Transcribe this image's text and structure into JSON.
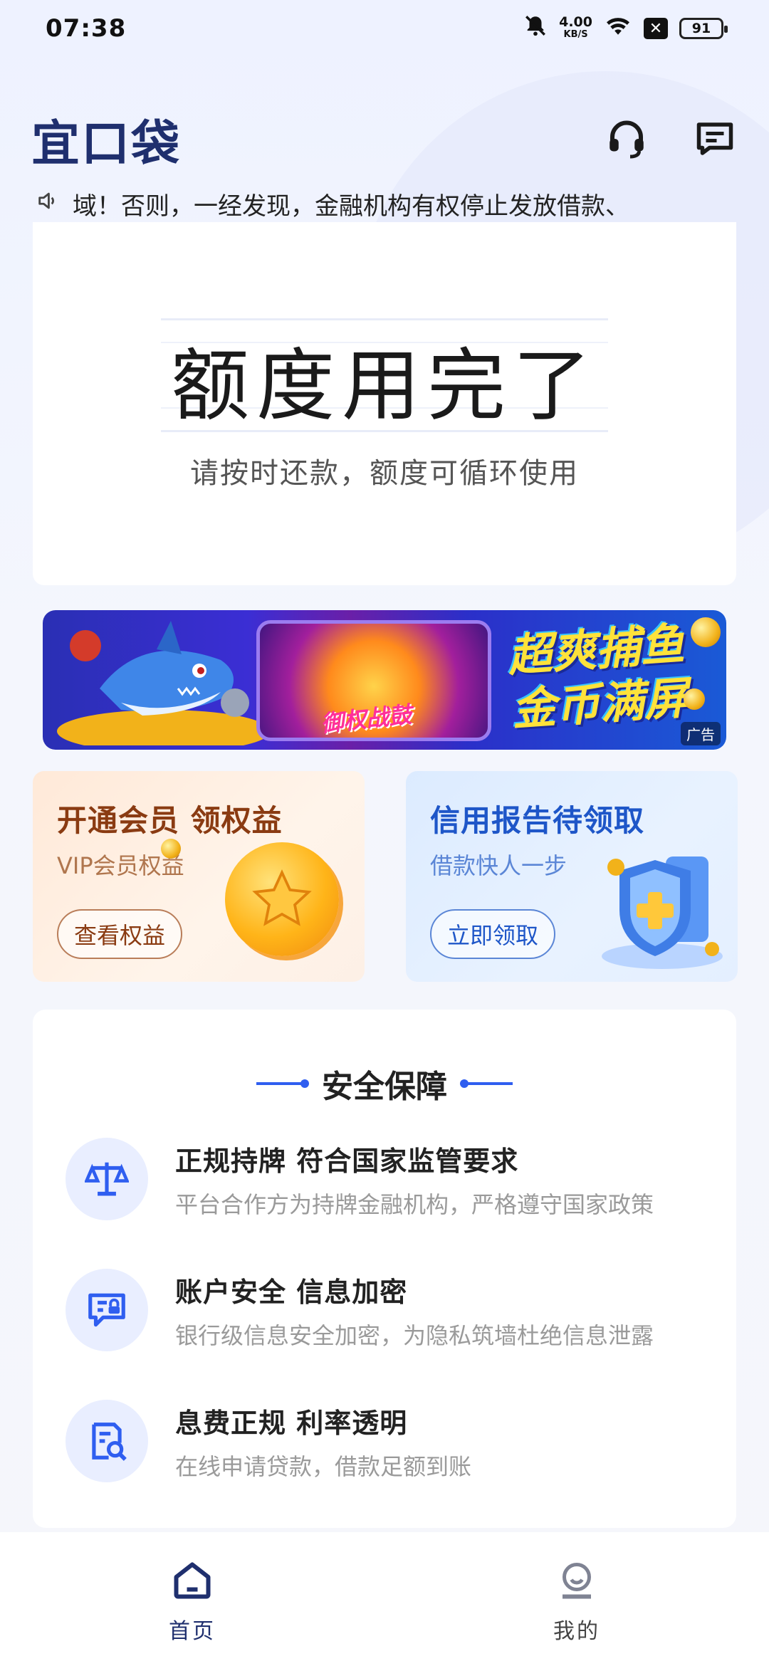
{
  "status_bar": {
    "time": "07:38",
    "net_speed": "4.00",
    "net_unit": "KB/S",
    "battery": "91",
    "icons": [
      "bell-muted-icon",
      "wifi-icon",
      "x-box-icon",
      "battery-icon"
    ]
  },
  "header": {
    "logo": "宜口袋",
    "icons": [
      "headset-icon",
      "message-icon"
    ]
  },
  "notice": {
    "text": "域！否则，一经发现，金融机构有权停止发放借款、"
  },
  "quota": {
    "title": "额度用完了",
    "subtitle": "请按时还款，额度可循环使用"
  },
  "banner_ad": {
    "wheel_text": "御权战鼓",
    "title_line1": "超爽捕鱼",
    "title_line2": "金币满屏",
    "ad_label": "广告"
  },
  "promos": {
    "vip": {
      "title": "开通会员 领权益",
      "subtitle": "VIP会员权益",
      "button": "查看权益"
    },
    "credit": {
      "title": "信用报告待领取",
      "subtitle": "借款快人一步",
      "button": "立即领取"
    }
  },
  "security": {
    "title": "安全保障",
    "items": [
      {
        "icon": "scale-icon",
        "title": "正规持牌 符合国家监管要求",
        "desc": "平台合作方为持牌金融机构，严格遵守国家政策"
      },
      {
        "icon": "secure-chat-icon",
        "title": "账户安全 信息加密",
        "desc": "银行级信息安全加密，为隐私筑墙杜绝信息泄露"
      },
      {
        "icon": "document-search-icon",
        "title": "息费正规  利率透明",
        "desc": "在线申请贷款，借款足额到账"
      }
    ]
  },
  "tabbar": {
    "items": [
      {
        "label": "首页",
        "icon": "home-icon",
        "active": true
      },
      {
        "label": "我的",
        "icon": "profile-icon",
        "active": false
      }
    ]
  },
  "colors": {
    "brand": "#1f2f6e",
    "accent_blue": "#2f5ef0",
    "vip_brown": "#8a3b12",
    "credit_blue": "#1e56c8"
  }
}
